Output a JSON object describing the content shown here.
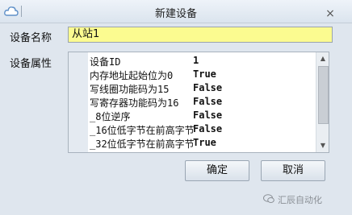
{
  "window": {
    "title": "新建设备",
    "close_icon": "×"
  },
  "fields": {
    "name_label": "设备名称",
    "name_value": "从站1",
    "props_label": "设备属性"
  },
  "properties": [
    {
      "name": "设备ID",
      "value": "1"
    },
    {
      "name": "内存地址起始位为0",
      "value": "True"
    },
    {
      "name": "写线圈功能码为15",
      "value": "False"
    },
    {
      "name": "写寄存器功能码为16",
      "value": "False"
    },
    {
      "name": "_8位逆序",
      "value": "False"
    },
    {
      "name": "_16位低字节在前高字节",
      "value": "False"
    },
    {
      "name": "_32位低字节在前高字节",
      "value": "True"
    }
  ],
  "buttons": {
    "ok": "确定",
    "cancel": "取消"
  },
  "watermark": {
    "text": "汇辰自动化"
  }
}
